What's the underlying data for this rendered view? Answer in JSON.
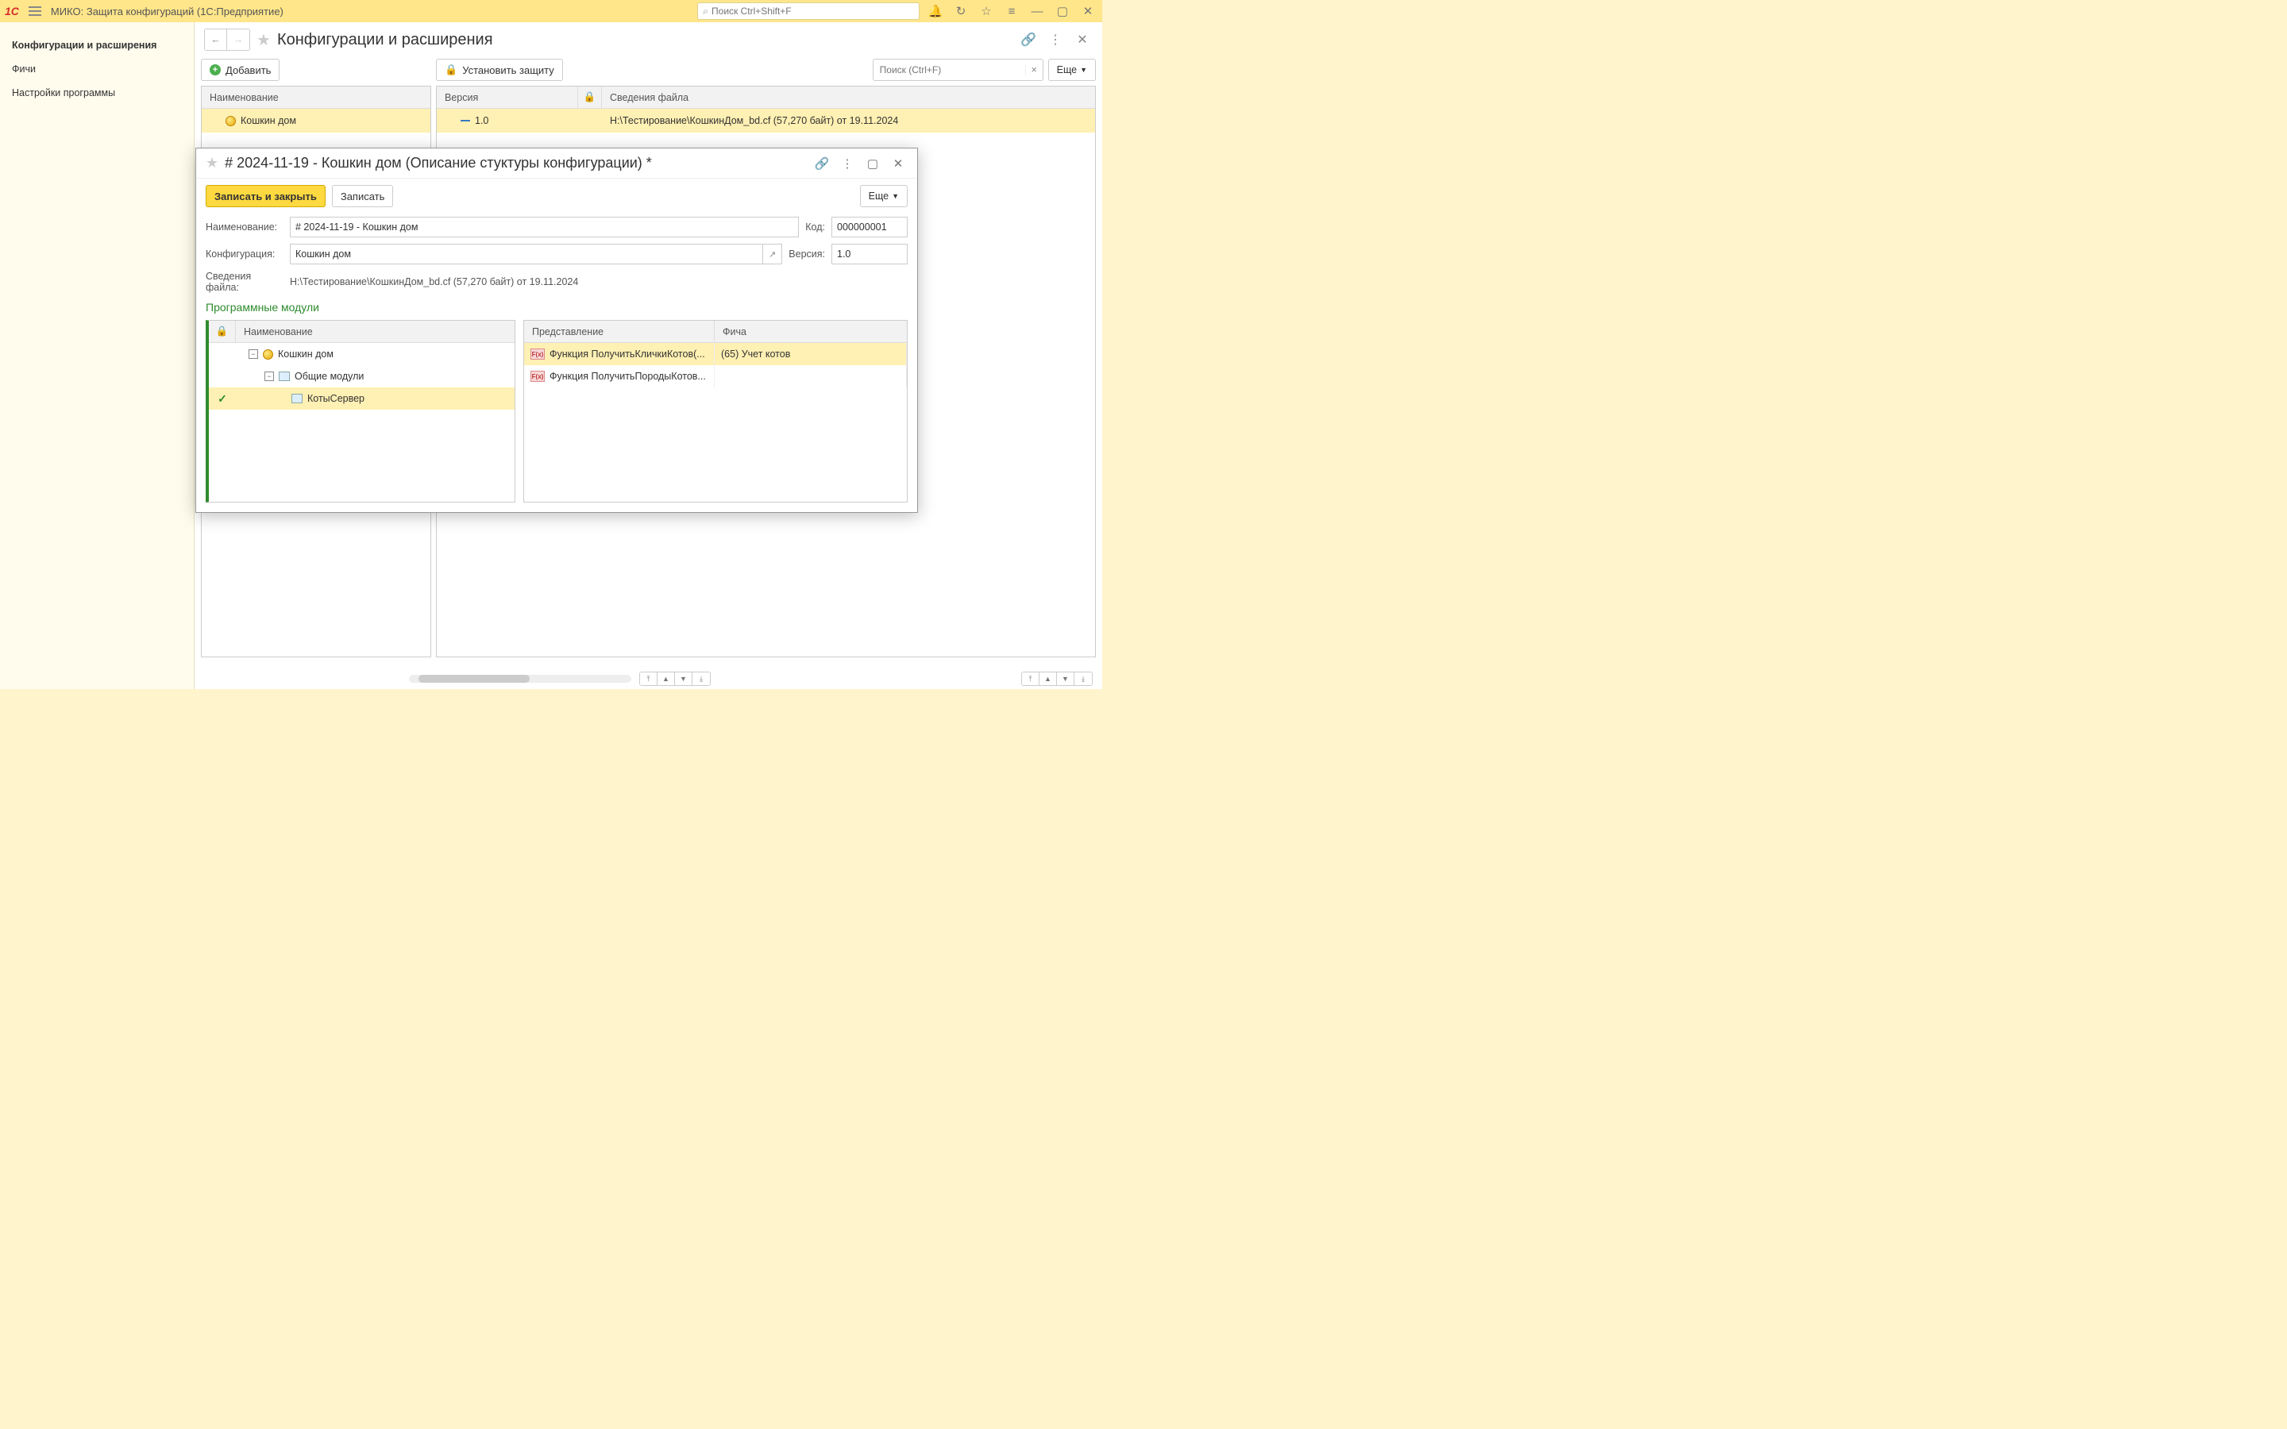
{
  "titlebar": {
    "app_title": "МИКО: Защита конфигураций  (1С:Предприятие)",
    "search_placeholder": "Поиск Ctrl+Shift+F"
  },
  "sidebar": {
    "items": [
      {
        "label": "Конфигурации и расширения"
      },
      {
        "label": "Фичи"
      },
      {
        "label": "Настройки программы"
      }
    ]
  },
  "page": {
    "title": "Конфигурации и расширения",
    "add_button": "Добавить",
    "protect_button": "Установить защиту",
    "search_placeholder": "Поиск (Ctrl+F)",
    "more": "Еще"
  },
  "left_table": {
    "header": "Наименование",
    "rows": [
      {
        "name": "Кошкин дом"
      }
    ]
  },
  "right_table": {
    "headers": {
      "version": "Версия",
      "file": "Сведения файла"
    },
    "rows": [
      {
        "version": "1.0",
        "file": "H:\\Тестирование\\КошкинДом_bd.cf (57,270 байт) от 19.11.2024"
      }
    ]
  },
  "dialog": {
    "title": "# 2024-11-19 - Кошкин дом (Описание стуктуры конфигурации) *",
    "save_close": "Записать и закрыть",
    "save": "Записать",
    "more": "Еще",
    "labels": {
      "name": "Наименование:",
      "code": "Код:",
      "config": "Конфигурация:",
      "version": "Версия:",
      "file": "Сведения файла:"
    },
    "values": {
      "name": "# 2024-11-19 - Кошкин дом",
      "code": "000000001",
      "config": "Кошкин дом",
      "version": "1.0",
      "file": "H:\\Тестирование\\КошкинДом_bd.cf (57,270 байт) от 19.11.2024"
    },
    "section": "Программные модули",
    "tree": {
      "header": "Наименование",
      "rows": [
        {
          "level": 0,
          "name": "Кошкин дом",
          "icon": "ball",
          "exp": "-"
        },
        {
          "level": 1,
          "name": "Общие модули",
          "icon": "mod",
          "exp": "-"
        },
        {
          "level": 2,
          "name": "КотыСервер",
          "icon": "mod",
          "selected": true,
          "checked": true
        }
      ]
    },
    "funcs": {
      "headers": {
        "repr": "Представление",
        "feature": "Фича"
      },
      "rows": [
        {
          "repr": "Функция  ПолучитьКличкиКотов(...",
          "feature": "(65) Учет котов",
          "sel": true
        },
        {
          "repr": "Функция  ПолучитьПородыКотов...",
          "feature": ""
        }
      ]
    }
  }
}
